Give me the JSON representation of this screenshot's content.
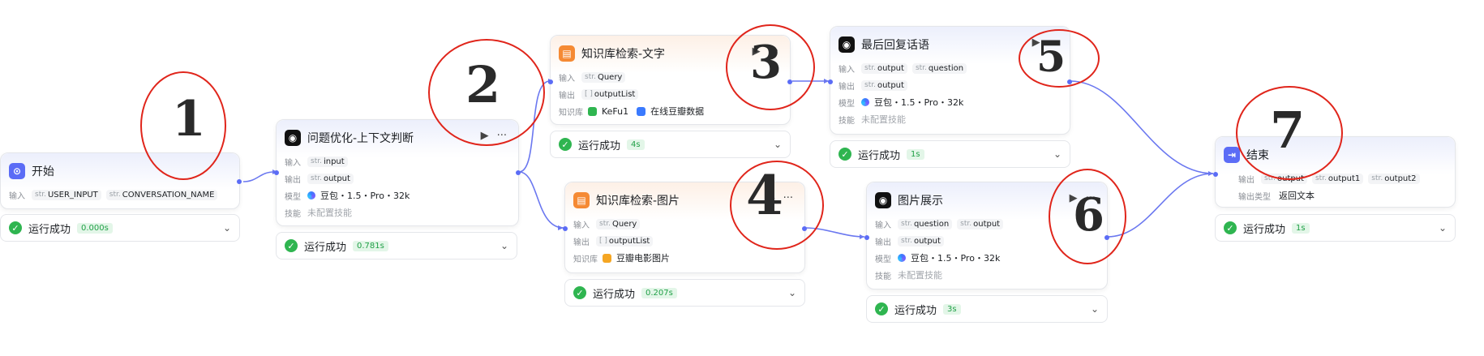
{
  "nodes": {
    "start": {
      "title": "开始",
      "input_label": "输入",
      "inputs": [
        "USER_INPUT",
        "CONVERSATION_NAME"
      ],
      "type_prefix": "str.",
      "status": {
        "text": "运行成功",
        "time": "0.000s"
      }
    },
    "rewrite": {
      "title": "问题优化-上下文判断",
      "input_label": "输入",
      "input": "input",
      "output_label": "输出",
      "output": "output",
      "model_label": "模型",
      "model": "豆包・1.5・Pro・32k",
      "skill_label": "技能",
      "skill": "未配置技能",
      "type_prefix": "str.",
      "status": {
        "text": "运行成功",
        "time": "0.781s"
      }
    },
    "kb_text": {
      "title": "知识库检索-文字",
      "input_label": "输入",
      "input": "Query",
      "input_type": "str.",
      "output_label": "输出",
      "output": "outputList",
      "output_type": "[ ]",
      "kb_label": "知识库",
      "kb_items": [
        "KeFu1",
        "在线豆瓣数据"
      ],
      "status": {
        "text": "运行成功",
        "time": "4s"
      }
    },
    "kb_image": {
      "title": "知识库检索-图片",
      "input_label": "输入",
      "input": "Query",
      "input_type": "str.",
      "output_label": "输出",
      "output": "outputList",
      "output_type": "[ ]",
      "kb_label": "知识库",
      "kb_items": [
        "豆瓣电影图片"
      ],
      "status": {
        "text": "运行成功",
        "time": "0.207s"
      }
    },
    "final_reply": {
      "title": "最后回复话语",
      "input_label": "输入",
      "inputs": [
        "output",
        "question"
      ],
      "output_label": "输出",
      "output": "output",
      "model_label": "模型",
      "model": "豆包・1.5・Pro・32k",
      "skill_label": "技能",
      "skill": "未配置技能",
      "type_prefix": "str.",
      "status": {
        "text": "运行成功",
        "time": "1s"
      }
    },
    "image_show": {
      "title": "图片展示",
      "input_label": "输入",
      "inputs": [
        "question",
        "output"
      ],
      "output_label": "输出",
      "output": "output",
      "model_label": "模型",
      "model": "豆包・1.5・Pro・32k",
      "skill_label": "技能",
      "skill": "未配置技能",
      "type_prefix": "str.",
      "status": {
        "text": "运行成功",
        "time": "3s"
      }
    },
    "end": {
      "title": "结束",
      "output_label": "输出",
      "outputs": [
        "output",
        "output1",
        "output2"
      ],
      "output_type_label": "输出类型",
      "output_type": "返回文本",
      "type_prefix": "str.",
      "status": {
        "text": "运行成功",
        "time": "1s"
      }
    }
  },
  "annotations": [
    "1",
    "2",
    "3",
    "4",
    "5",
    "6",
    "7"
  ],
  "colors": {
    "accent": "#5b6cf6",
    "success": "#2fb550",
    "annotation": "#e0251b"
  },
  "icons": {
    "run": "play-icon",
    "more": "more-icon",
    "expand": "chevron-down-icon",
    "success": "check-circle-icon"
  }
}
